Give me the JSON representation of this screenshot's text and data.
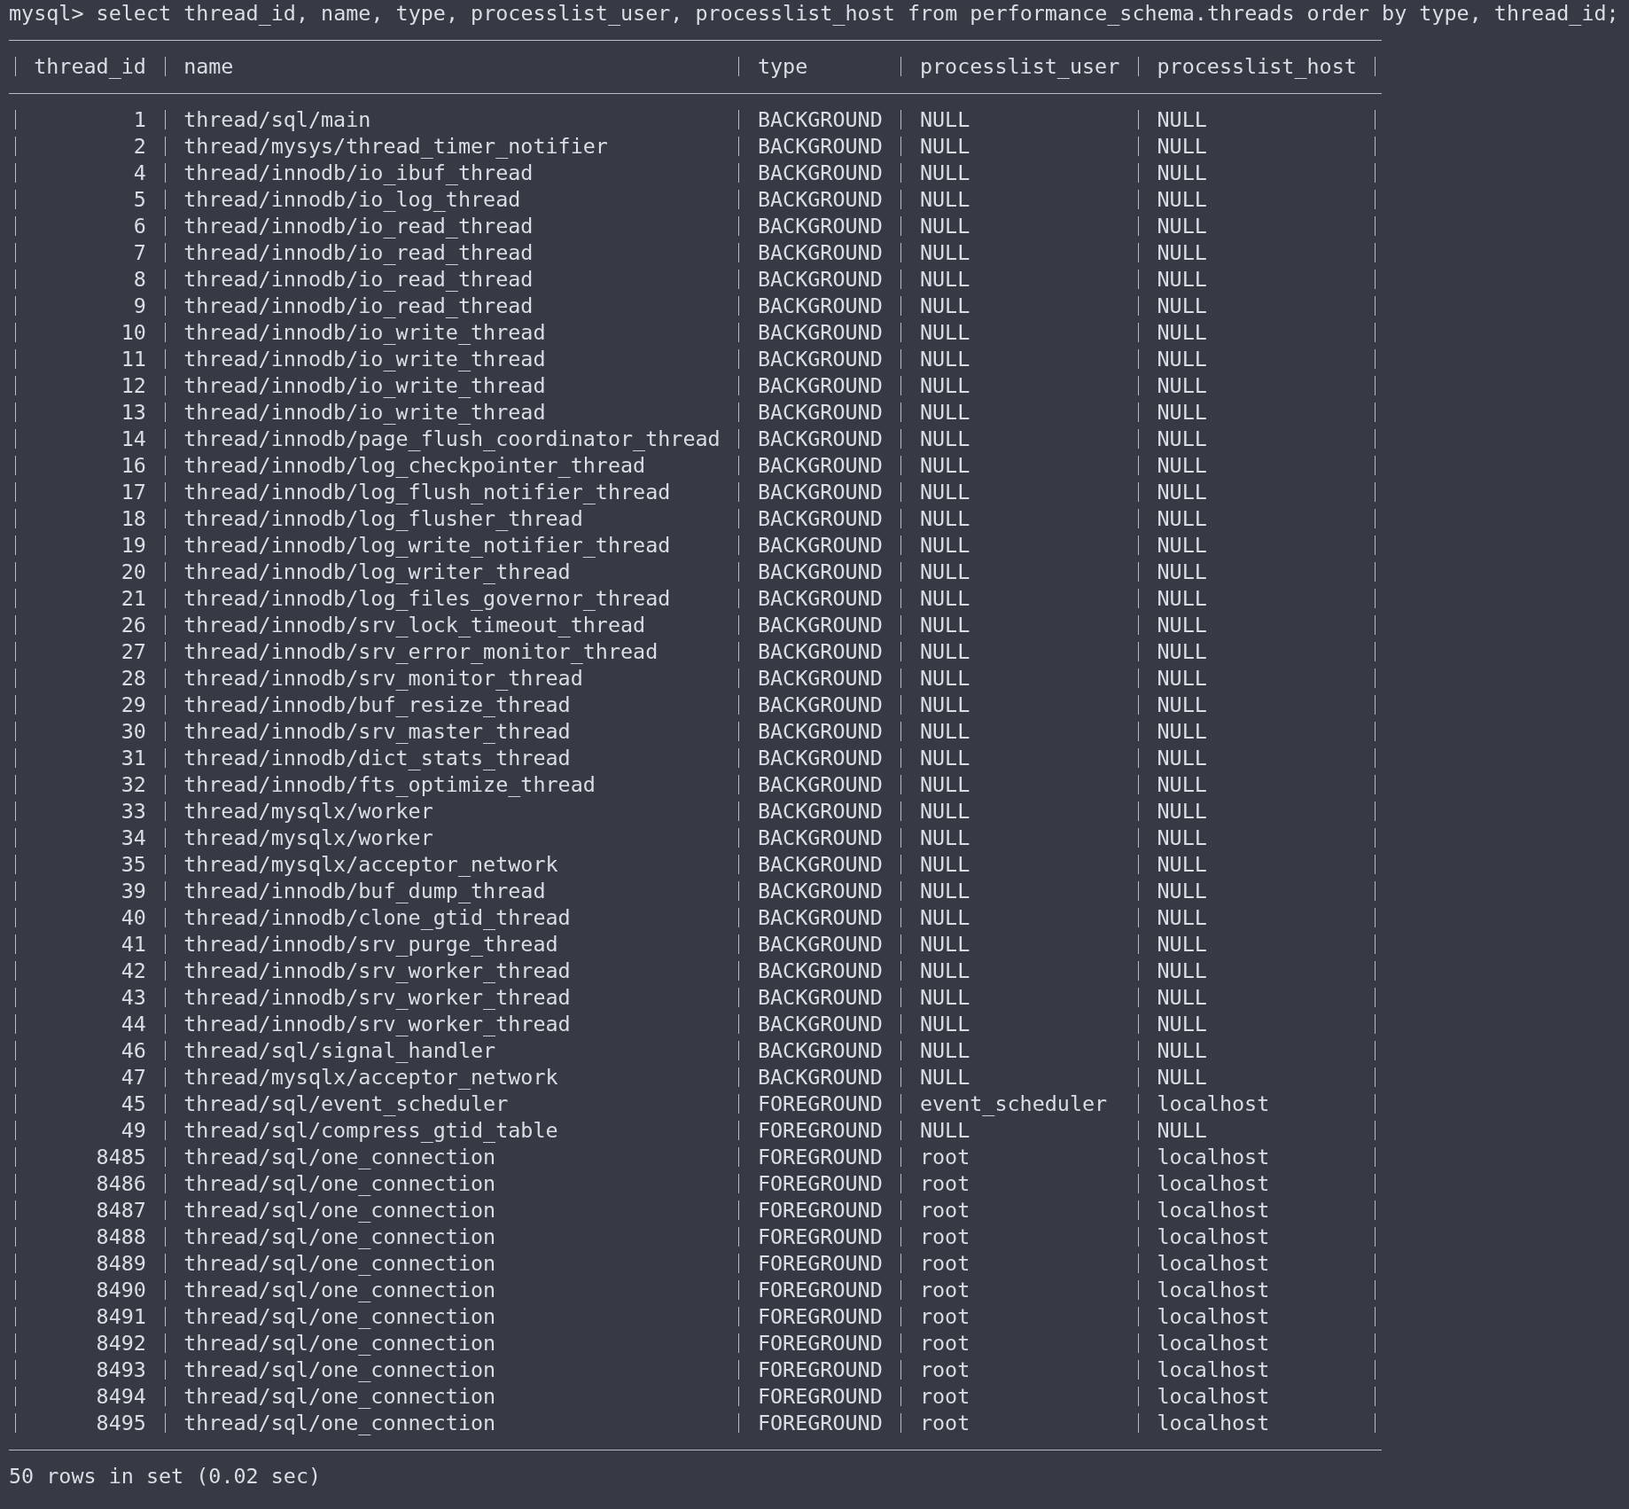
{
  "command": "mysql> select thread_id, name, type, processlist_user, processlist_host from performance_schema.threads order by type, thread_id;",
  "table": {
    "columns": [
      "thread_id",
      "name",
      "type",
      "processlist_user",
      "processlist_host"
    ],
    "rows": [
      [
        "1",
        "thread/sql/main",
        "BACKGROUND",
        "NULL",
        "NULL"
      ],
      [
        "2",
        "thread/mysys/thread_timer_notifier",
        "BACKGROUND",
        "NULL",
        "NULL"
      ],
      [
        "4",
        "thread/innodb/io_ibuf_thread",
        "BACKGROUND",
        "NULL",
        "NULL"
      ],
      [
        "5",
        "thread/innodb/io_log_thread",
        "BACKGROUND",
        "NULL",
        "NULL"
      ],
      [
        "6",
        "thread/innodb/io_read_thread",
        "BACKGROUND",
        "NULL",
        "NULL"
      ],
      [
        "7",
        "thread/innodb/io_read_thread",
        "BACKGROUND",
        "NULL",
        "NULL"
      ],
      [
        "8",
        "thread/innodb/io_read_thread",
        "BACKGROUND",
        "NULL",
        "NULL"
      ],
      [
        "9",
        "thread/innodb/io_read_thread",
        "BACKGROUND",
        "NULL",
        "NULL"
      ],
      [
        "10",
        "thread/innodb/io_write_thread",
        "BACKGROUND",
        "NULL",
        "NULL"
      ],
      [
        "11",
        "thread/innodb/io_write_thread",
        "BACKGROUND",
        "NULL",
        "NULL"
      ],
      [
        "12",
        "thread/innodb/io_write_thread",
        "BACKGROUND",
        "NULL",
        "NULL"
      ],
      [
        "13",
        "thread/innodb/io_write_thread",
        "BACKGROUND",
        "NULL",
        "NULL"
      ],
      [
        "14",
        "thread/innodb/page_flush_coordinator_thread",
        "BACKGROUND",
        "NULL",
        "NULL"
      ],
      [
        "16",
        "thread/innodb/log_checkpointer_thread",
        "BACKGROUND",
        "NULL",
        "NULL"
      ],
      [
        "17",
        "thread/innodb/log_flush_notifier_thread",
        "BACKGROUND",
        "NULL",
        "NULL"
      ],
      [
        "18",
        "thread/innodb/log_flusher_thread",
        "BACKGROUND",
        "NULL",
        "NULL"
      ],
      [
        "19",
        "thread/innodb/log_write_notifier_thread",
        "BACKGROUND",
        "NULL",
        "NULL"
      ],
      [
        "20",
        "thread/innodb/log_writer_thread",
        "BACKGROUND",
        "NULL",
        "NULL"
      ],
      [
        "21",
        "thread/innodb/log_files_governor_thread",
        "BACKGROUND",
        "NULL",
        "NULL"
      ],
      [
        "26",
        "thread/innodb/srv_lock_timeout_thread",
        "BACKGROUND",
        "NULL",
        "NULL"
      ],
      [
        "27",
        "thread/innodb/srv_error_monitor_thread",
        "BACKGROUND",
        "NULL",
        "NULL"
      ],
      [
        "28",
        "thread/innodb/srv_monitor_thread",
        "BACKGROUND",
        "NULL",
        "NULL"
      ],
      [
        "29",
        "thread/innodb/buf_resize_thread",
        "BACKGROUND",
        "NULL",
        "NULL"
      ],
      [
        "30",
        "thread/innodb/srv_master_thread",
        "BACKGROUND",
        "NULL",
        "NULL"
      ],
      [
        "31",
        "thread/innodb/dict_stats_thread",
        "BACKGROUND",
        "NULL",
        "NULL"
      ],
      [
        "32",
        "thread/innodb/fts_optimize_thread",
        "BACKGROUND",
        "NULL",
        "NULL"
      ],
      [
        "33",
        "thread/mysqlx/worker",
        "BACKGROUND",
        "NULL",
        "NULL"
      ],
      [
        "34",
        "thread/mysqlx/worker",
        "BACKGROUND",
        "NULL",
        "NULL"
      ],
      [
        "35",
        "thread/mysqlx/acceptor_network",
        "BACKGROUND",
        "NULL",
        "NULL"
      ],
      [
        "39",
        "thread/innodb/buf_dump_thread",
        "BACKGROUND",
        "NULL",
        "NULL"
      ],
      [
        "40",
        "thread/innodb/clone_gtid_thread",
        "BACKGROUND",
        "NULL",
        "NULL"
      ],
      [
        "41",
        "thread/innodb/srv_purge_thread",
        "BACKGROUND",
        "NULL",
        "NULL"
      ],
      [
        "42",
        "thread/innodb/srv_worker_thread",
        "BACKGROUND",
        "NULL",
        "NULL"
      ],
      [
        "43",
        "thread/innodb/srv_worker_thread",
        "BACKGROUND",
        "NULL",
        "NULL"
      ],
      [
        "44",
        "thread/innodb/srv_worker_thread",
        "BACKGROUND",
        "NULL",
        "NULL"
      ],
      [
        "46",
        "thread/sql/signal_handler",
        "BACKGROUND",
        "NULL",
        "NULL"
      ],
      [
        "47",
        "thread/mysqlx/acceptor_network",
        "BACKGROUND",
        "NULL",
        "NULL"
      ],
      [
        "45",
        "thread/sql/event_scheduler",
        "FOREGROUND",
        "event_scheduler",
        "localhost"
      ],
      [
        "49",
        "thread/sql/compress_gtid_table",
        "FOREGROUND",
        "NULL",
        "NULL"
      ],
      [
        "8485",
        "thread/sql/one_connection",
        "FOREGROUND",
        "root",
        "localhost"
      ],
      [
        "8486",
        "thread/sql/one_connection",
        "FOREGROUND",
        "root",
        "localhost"
      ],
      [
        "8487",
        "thread/sql/one_connection",
        "FOREGROUND",
        "root",
        "localhost"
      ],
      [
        "8488",
        "thread/sql/one_connection",
        "FOREGROUND",
        "root",
        "localhost"
      ],
      [
        "8489",
        "thread/sql/one_connection",
        "FOREGROUND",
        "root",
        "localhost"
      ],
      [
        "8490",
        "thread/sql/one_connection",
        "FOREGROUND",
        "root",
        "localhost"
      ],
      [
        "8491",
        "thread/sql/one_connection",
        "FOREGROUND",
        "root",
        "localhost"
      ],
      [
        "8492",
        "thread/sql/one_connection",
        "FOREGROUND",
        "root",
        "localhost"
      ],
      [
        "8493",
        "thread/sql/one_connection",
        "FOREGROUND",
        "root",
        "localhost"
      ],
      [
        "8494",
        "thread/sql/one_connection",
        "FOREGROUND",
        "root",
        "localhost"
      ],
      [
        "8495",
        "thread/sql/one_connection",
        "FOREGROUND",
        "root",
        "localhost"
      ]
    ]
  },
  "result": "50 rows in set (0.02 sec)"
}
